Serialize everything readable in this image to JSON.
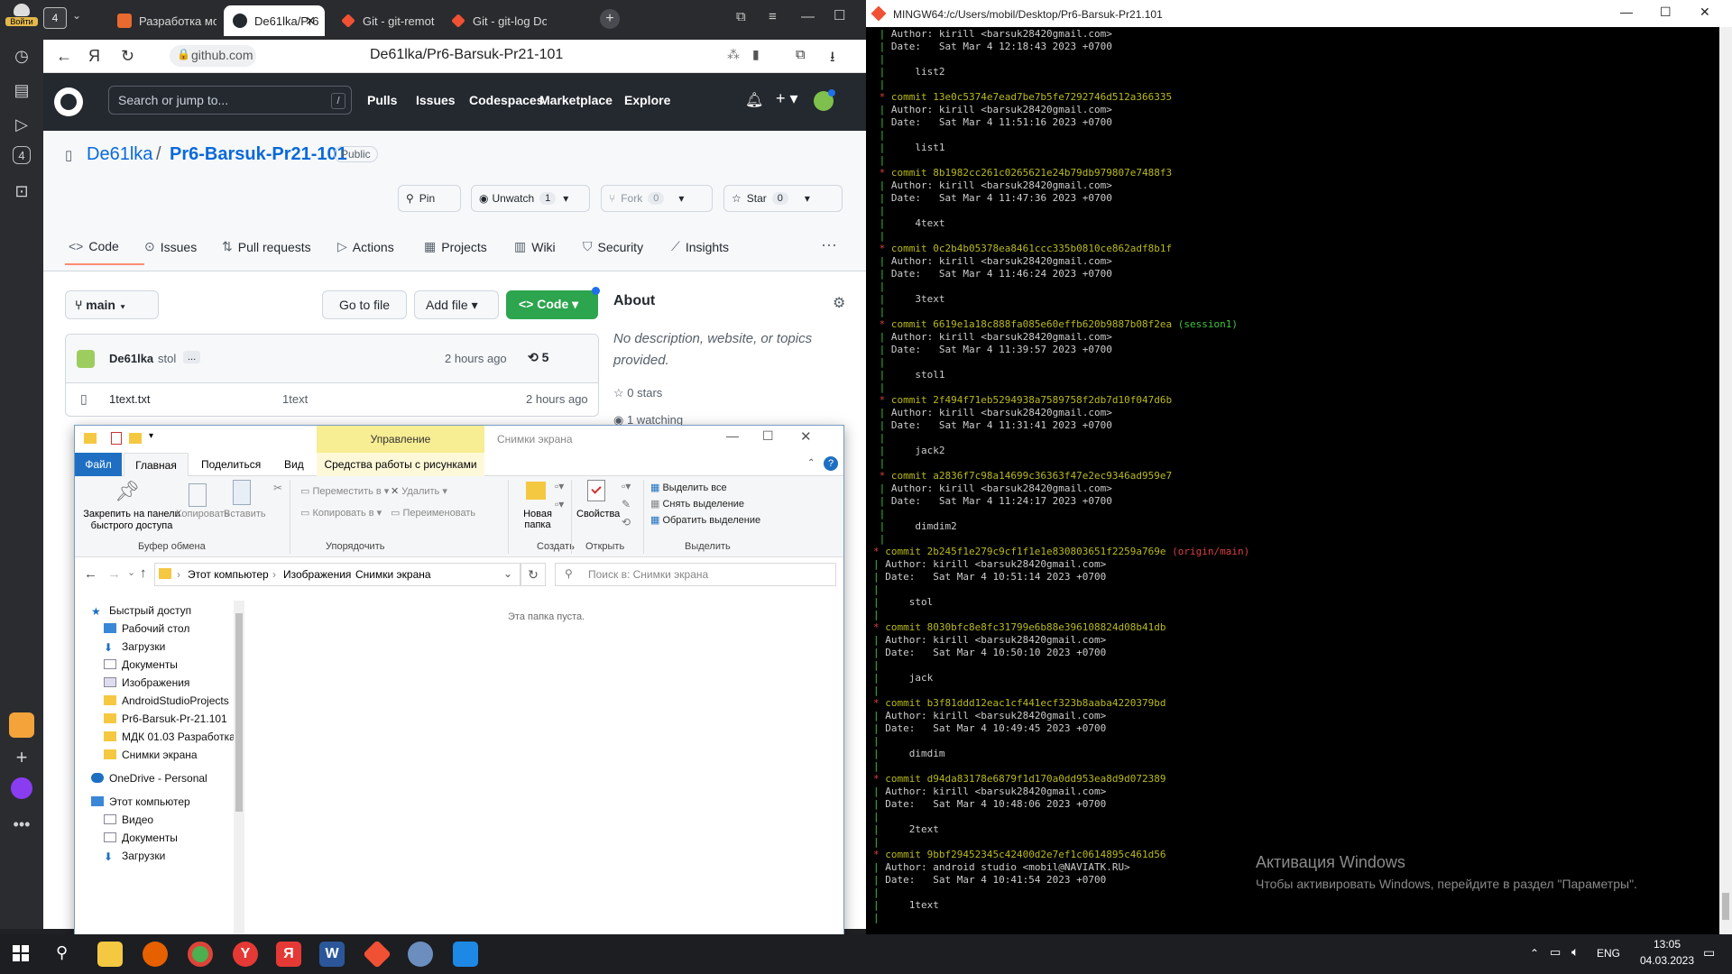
{
  "yandex_sidebar": {
    "login_label": "Войти",
    "tab_count": "4"
  },
  "browser": {
    "tabs": [
      {
        "title": "Разработка мо"
      },
      {
        "title": "De61lka/Pr6"
      },
      {
        "title": "Git - git-remot"
      },
      {
        "title": "Git - git-log Do"
      }
    ],
    "tab_group_count": "4",
    "url_host": "github.com",
    "page_title": "De61lka/Pr6-Barsuk-Pr21-101"
  },
  "github": {
    "search_placeholder": "Search or jump to...",
    "search_shortcut": "/",
    "nav": [
      "Pulls",
      "Issues",
      "Codespaces",
      "Marketplace",
      "Explore"
    ],
    "owner": "De61lka",
    "repo": "Pr6-Barsuk-Pr21-101",
    "visibility": "Public",
    "buttons": {
      "pin": "Pin",
      "unwatch": "Unwatch",
      "unwatch_count": "1",
      "fork": "Fork",
      "fork_count": "0",
      "star": "Star",
      "star_count": "0"
    },
    "tabs": [
      "Code",
      "Issues",
      "Pull requests",
      "Actions",
      "Projects",
      "Wiki",
      "Security",
      "Insights"
    ],
    "branch": "main",
    "go_to_file": "Go to file",
    "add_file": "Add file",
    "code_button": "Code",
    "commit_author": "De61lka",
    "commit_msg": "stol",
    "commit_ellipsis": "...",
    "commit_time": "2 hours ago",
    "commit_count": "5",
    "file_row": {
      "name": "1text.txt",
      "msg": "1text",
      "time": "2 hours ago"
    },
    "about": {
      "title": "About",
      "desc": "No description, website, or topics provided.",
      "stars": "0 stars",
      "watching": "1 watching"
    }
  },
  "explorer": {
    "context_tab": "Управление",
    "window_title": "Снимки экрана",
    "ribbon_tabs": [
      "Файл",
      "Главная",
      "Поделиться",
      "Вид",
      "Средства работы с рисунками"
    ],
    "clipboard": {
      "pin": "Закрепить на панели быстрого доступа",
      "copy": "Копировать",
      "paste": "Вставить",
      "group": "Буфер обмена"
    },
    "organize": {
      "move": "Переместить в",
      "copy_to": "Копировать в",
      "delete": "Удалить",
      "rename": "Переименовать",
      "group": "Упорядочить"
    },
    "create": {
      "new_folder": "Новая папка",
      "group": "Создать"
    },
    "open": {
      "properties": "Свойства",
      "group": "Открыть"
    },
    "select": {
      "all": "Выделить все",
      "none": "Снять выделение",
      "invert": "Обратить выделение",
      "group": "Выделить"
    },
    "breadcrumb": [
      "Этот компьютер",
      "Изображения",
      "Снимки экрана"
    ],
    "search_placeholder": "Поиск в: Снимки экрана",
    "empty_text": "Эта папка пуста.",
    "tree": [
      "Быстрый доступ",
      "Рабочий стол",
      "Загрузки",
      "Документы",
      "Изображения",
      "AndroidStudioProjects",
      "Pr6-Barsuk-Pr-21.101",
      "МДК 01.03 Разработка",
      "Снимки экрана",
      "OneDrive - Personal",
      "Этот компьютер",
      "Видео",
      "Документы",
      "Загрузки"
    ]
  },
  "terminal": {
    "title": "MINGW64:/c/Users/mobil/Desktop/Pr6-Barsuk-Pr21.101",
    "commits": [
      {
        "graph": "/",
        "hash": "",
        "author": "kirill <barsuk28420gmail.com>",
        "date": "Sat Mar 4 12:18:43 2023 +0700",
        "msg": "list2"
      },
      {
        "graph": "*",
        "hash": "13e0c5374e7ead7be7b5fe7292746d512a366335",
        "author": "kirill <barsuk28420gmail.com>",
        "date": "Sat Mar 4 11:51:16 2023 +0700",
        "msg": "list1"
      },
      {
        "graph": "*",
        "hash": "8b1982cc261c0265621e24b79db979807e7488f3",
        "author": "kirill <barsuk28420gmail.com>",
        "date": "Sat Mar 4 11:47:36 2023 +0700",
        "msg": "4text"
      },
      {
        "graph": "*",
        "hash": "0c2b4b05378ea8461ccc335b0810ce862adf8b1f",
        "author": "kirill <barsuk28420gmail.com>",
        "date": "Sat Mar 4 11:46:24 2023 +0700",
        "msg": "3text"
      },
      {
        "graph": "*",
        "hash": "6619e1a18c888fa085e60effb620b9887b08f2ea",
        "ref": "(session1)",
        "author": "kirill <barsuk28420gmail.com>",
        "date": "Sat Mar 4 11:39:57 2023 +0700",
        "msg": "stol1"
      },
      {
        "graph": "*",
        "hash": "2f494f71eb5294938a7589758f2db7d10f047d6b",
        "author": "kirill <barsuk28420gmail.com>",
        "date": "Sat Mar 4 11:31:41 2023 +0700",
        "msg": "jack2"
      },
      {
        "graph": "*",
        "hash": "a2836f7c98a14699c36363f47e2ec9346ad959e7",
        "author": "kirill <barsuk28420gmail.com>",
        "date": "Sat Mar 4 11:24:17 2023 +0700",
        "msg": "dimdim2"
      },
      {
        "graph": "*",
        "hash": "2b245f1e279c9cf1f1e1e830803651f2259a769e",
        "ref": "(origin/main)",
        "author": "kirill <barsuk28420gmail.com>",
        "date": "Sat Mar 4 10:51:14 2023 +0700",
        "msg": "stol"
      },
      {
        "graph": "*",
        "hash": "8030bfc8e8fc31799e6b88e396108824d08b41db",
        "author": "kirill <barsuk28420gmail.com>",
        "date": "Sat Mar 4 10:50:10 2023 +0700",
        "msg": "jack"
      },
      {
        "graph": "*",
        "hash": "b3f81ddd12eac1cf441ecf323b8aaba4220379bd",
        "author": "kirill <barsuk28420gmail.com>",
        "date": "Sat Mar 4 10:49:45 2023 +0700",
        "msg": "dimdim"
      },
      {
        "graph": "*",
        "hash": "d94da83178e6879f1d170a0dd953ea8d9d072389",
        "author": "kirill <barsuk28420gmail.com>",
        "date": "Sat Mar 4 10:48:06 2023 +0700",
        "msg": "2text"
      },
      {
        "graph": "*",
        "hash": "9bbf29452345c42400d2e7ef1c0614895c461d56",
        "author": "android studio <mobil@NAVIATK.RU>",
        "date": "Sat Mar 4 10:41:54 2023 +0700",
        "msg": "1text"
      }
    ]
  },
  "watermark": {
    "line1": "Активация Windows",
    "line2": "Чтобы активировать Windows, перейдите в раздел \"Параметры\"."
  },
  "taskbar": {
    "lang": "ENG",
    "time": "13:05",
    "date": "04.03.2023"
  }
}
